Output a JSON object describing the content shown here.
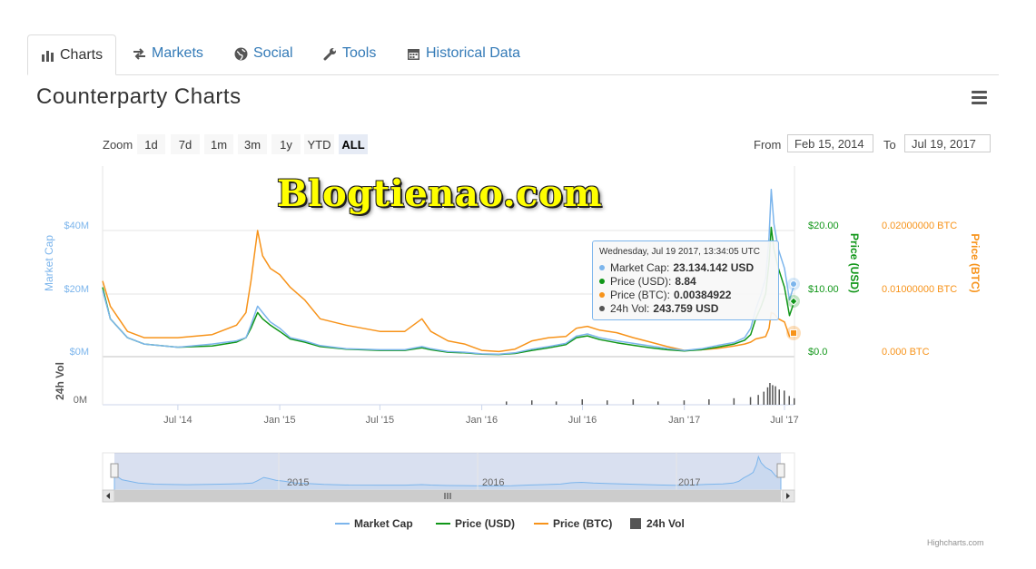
{
  "tabs": [
    {
      "label": "Charts",
      "icon": "bar-chart-icon"
    },
    {
      "label": "Markets",
      "icon": "exchange-icon"
    },
    {
      "label": "Social",
      "icon": "globe-icon"
    },
    {
      "label": "Tools",
      "icon": "wrench-icon"
    },
    {
      "label": "Historical Data",
      "icon": "calendar-icon"
    }
  ],
  "page_title": "Counterparty Charts",
  "zoom": {
    "label": "Zoom",
    "buttons": [
      "1d",
      "7d",
      "1m",
      "3m",
      "1y",
      "YTD",
      "ALL"
    ],
    "selected": "ALL"
  },
  "range": {
    "from_label": "From",
    "from_value": "Feb 15, 2014",
    "to_label": "To",
    "to_value": "Jul 19, 2017"
  },
  "watermark": "Blogtienao.com",
  "tooltip": {
    "header": "Wednesday, Jul 19 2017, 13:34:05 UTC",
    "rows": [
      {
        "name": "Market Cap",
        "value": "23.134.142 USD"
      },
      {
        "name": "Price (USD)",
        "value": "8.84"
      },
      {
        "name": "Price (BTC)",
        "value": "0.00384922"
      },
      {
        "name": "24h Vol",
        "value": "243.759 USD"
      }
    ]
  },
  "legend": [
    "Market Cap",
    "Price (USD)",
    "Price (BTC)",
    "24h Vol"
  ],
  "credits": "Highcharts.com",
  "colors": {
    "market_cap": "#7cb5ec",
    "price_usd": "#109618",
    "price_btc": "#f7931a",
    "volume": "#555555",
    "link": "#337ab7"
  },
  "chart_data": {
    "type": "line",
    "x_ticks": [
      "Jul '14",
      "Jan '15",
      "Jul '15",
      "Jan '16",
      "Jul '16",
      "Jan '17",
      "Jul '17"
    ],
    "axes": {
      "market_cap": {
        "label": "Market Cap",
        "ticks": [
          "$0M",
          "$20M",
          "$40M"
        ],
        "range": [
          0,
          40
        ]
      },
      "price_usd": {
        "label": "Price (USD)",
        "ticks": [
          "$0.0",
          "$10.00",
          "$20.00"
        ],
        "range": [
          0,
          20
        ]
      },
      "price_btc": {
        "label": "Price (BTC)",
        "ticks": [
          "0.000 BTC",
          "0.01000000 BTC",
          "0.02000000 BTC"
        ],
        "range": [
          0,
          0.02
        ]
      },
      "volume": {
        "label": "24h Vol",
        "ticks": [
          "0M"
        ]
      }
    },
    "x_range": [
      "2014-02-15",
      "2017-07-19"
    ],
    "navigator_ticks": [
      "2015",
      "2016",
      "2017"
    ],
    "series": [
      {
        "name": "Market Cap",
        "unit": "$M",
        "points": [
          [
            "2014-02-15",
            21
          ],
          [
            "2014-03-01",
            12
          ],
          [
            "2014-04-01",
            6
          ],
          [
            "2014-05-01",
            4
          ],
          [
            "2014-07-01",
            3
          ],
          [
            "2014-09-01",
            4
          ],
          [
            "2014-10-15",
            5
          ],
          [
            "2014-11-01",
            6
          ],
          [
            "2014-11-10",
            10
          ],
          [
            "2014-11-22",
            16
          ],
          [
            "2014-12-01",
            14
          ],
          [
            "2014-12-15",
            11
          ],
          [
            "2015-01-01",
            9
          ],
          [
            "2015-01-20",
            6
          ],
          [
            "2015-02-15",
            5
          ],
          [
            "2015-03-15",
            3.5
          ],
          [
            "2015-05-01",
            2.5
          ],
          [
            "2015-07-01",
            2.2
          ],
          [
            "2015-08-15",
            2.2
          ],
          [
            "2015-09-15",
            3.2
          ],
          [
            "2015-10-01",
            2.5
          ],
          [
            "2015-11-01",
            1.6
          ],
          [
            "2015-12-01",
            1.4
          ],
          [
            "2016-01-01",
            0.9
          ],
          [
            "2016-02-01",
            0.8
          ],
          [
            "2016-03-01",
            1.2
          ],
          [
            "2016-04-01",
            2.4
          ],
          [
            "2016-05-01",
            3.2
          ],
          [
            "2016-06-01",
            4.2
          ],
          [
            "2016-06-20",
            6.5
          ],
          [
            "2016-07-10",
            7.2
          ],
          [
            "2016-08-01",
            6
          ],
          [
            "2016-09-01",
            5
          ],
          [
            "2016-10-01",
            4.2
          ],
          [
            "2016-11-01",
            3.4
          ],
          [
            "2016-12-01",
            2.6
          ],
          [
            "2017-01-01",
            2
          ],
          [
            "2017-02-01",
            2.5
          ],
          [
            "2017-03-01",
            3.5
          ],
          [
            "2017-04-01",
            4.5
          ],
          [
            "2017-04-20",
            6
          ],
          [
            "2017-05-01",
            9
          ],
          [
            "2017-05-10",
            15
          ],
          [
            "2017-05-20",
            20
          ],
          [
            "2017-05-28",
            25
          ],
          [
            "2017-06-03",
            38
          ],
          [
            "2017-06-07",
            53
          ],
          [
            "2017-06-12",
            42
          ],
          [
            "2017-06-20",
            34
          ],
          [
            "2017-07-01",
            28
          ],
          [
            "2017-07-10",
            18
          ],
          [
            "2017-07-19",
            23.1
          ]
        ]
      },
      {
        "name": "Price (USD)",
        "unit": "USD",
        "points": [
          [
            "2014-02-15",
            11
          ],
          [
            "2014-03-01",
            6
          ],
          [
            "2014-04-01",
            3
          ],
          [
            "2014-05-01",
            2
          ],
          [
            "2014-07-01",
            1.5
          ],
          [
            "2014-09-01",
            1.7
          ],
          [
            "2014-10-15",
            2.3
          ],
          [
            "2014-11-01",
            3
          ],
          [
            "2014-11-10",
            4.5
          ],
          [
            "2014-11-22",
            7
          ],
          [
            "2014-12-01",
            6
          ],
          [
            "2014-12-15",
            5
          ],
          [
            "2015-01-01",
            4
          ],
          [
            "2015-01-20",
            2.8
          ],
          [
            "2015-02-15",
            2.3
          ],
          [
            "2015-03-15",
            1.6
          ],
          [
            "2015-05-01",
            1.2
          ],
          [
            "2015-07-01",
            1
          ],
          [
            "2015-08-15",
            1
          ],
          [
            "2015-09-15",
            1.4
          ],
          [
            "2015-10-01",
            1.1
          ],
          [
            "2015-11-01",
            0.7
          ],
          [
            "2015-12-01",
            0.6
          ],
          [
            "2016-01-01",
            0.4
          ],
          [
            "2016-02-01",
            0.35
          ],
          [
            "2016-03-01",
            0.5
          ],
          [
            "2016-04-01",
            1
          ],
          [
            "2016-05-01",
            1.4
          ],
          [
            "2016-06-01",
            1.9
          ],
          [
            "2016-06-20",
            3
          ],
          [
            "2016-07-10",
            3.3
          ],
          [
            "2016-08-01",
            2.7
          ],
          [
            "2016-09-01",
            2.2
          ],
          [
            "2016-10-01",
            1.8
          ],
          [
            "2016-11-01",
            1.4
          ],
          [
            "2016-12-01",
            1.1
          ],
          [
            "2017-01-01",
            0.9
          ],
          [
            "2017-02-01",
            1.1
          ],
          [
            "2017-03-01",
            1.5
          ],
          [
            "2017-04-01",
            2
          ],
          [
            "2017-04-20",
            2.6
          ],
          [
            "2017-05-01",
            3.5
          ],
          [
            "2017-05-10",
            6
          ],
          [
            "2017-05-20",
            8
          ],
          [
            "2017-05-28",
            10
          ],
          [
            "2017-06-03",
            15
          ],
          [
            "2017-06-07",
            20.5
          ],
          [
            "2017-06-12",
            17
          ],
          [
            "2017-06-20",
            14
          ],
          [
            "2017-07-01",
            11
          ],
          [
            "2017-07-10",
            6.5
          ],
          [
            "2017-07-19",
            8.84
          ]
        ]
      },
      {
        "name": "Price (BTC)",
        "unit": "BTC",
        "points": [
          [
            "2014-02-15",
            0.012
          ],
          [
            "2014-03-01",
            0.008
          ],
          [
            "2014-04-01",
            0.004
          ],
          [
            "2014-05-01",
            0.003
          ],
          [
            "2014-07-01",
            0.003
          ],
          [
            "2014-09-01",
            0.0035
          ],
          [
            "2014-10-15",
            0.005
          ],
          [
            "2014-11-01",
            0.007
          ],
          [
            "2014-11-10",
            0.012
          ],
          [
            "2014-11-22",
            0.02
          ],
          [
            "2014-12-01",
            0.016
          ],
          [
            "2014-12-15",
            0.014
          ],
          [
            "2015-01-01",
            0.013
          ],
          [
            "2015-01-20",
            0.011
          ],
          [
            "2015-02-15",
            0.009
          ],
          [
            "2015-03-15",
            0.006
          ],
          [
            "2015-05-01",
            0.005
          ],
          [
            "2015-07-01",
            0.004
          ],
          [
            "2015-08-15",
            0.004
          ],
          [
            "2015-09-15",
            0.006
          ],
          [
            "2015-10-01",
            0.004
          ],
          [
            "2015-11-01",
            0.0025
          ],
          [
            "2015-12-01",
            0.002
          ],
          [
            "2016-01-01",
            0.001
          ],
          [
            "2016-02-01",
            0.0008
          ],
          [
            "2016-03-01",
            0.0012
          ],
          [
            "2016-04-01",
            0.0025
          ],
          [
            "2016-05-01",
            0.003
          ],
          [
            "2016-06-01",
            0.0032
          ],
          [
            "2016-06-20",
            0.0045
          ],
          [
            "2016-07-10",
            0.0048
          ],
          [
            "2016-08-01",
            0.0042
          ],
          [
            "2016-09-01",
            0.0038
          ],
          [
            "2016-10-01",
            0.003
          ],
          [
            "2016-11-01",
            0.0023
          ],
          [
            "2016-12-01",
            0.0016
          ],
          [
            "2017-01-01",
            0.001
          ],
          [
            "2017-02-01",
            0.0011
          ],
          [
            "2017-03-01",
            0.0013
          ],
          [
            "2017-04-01",
            0.0017
          ],
          [
            "2017-04-20",
            0.002
          ],
          [
            "2017-05-01",
            0.0023
          ],
          [
            "2017-05-10",
            0.0028
          ],
          [
            "2017-05-20",
            0.003
          ],
          [
            "2017-05-28",
            0.0032
          ],
          [
            "2017-06-03",
            0.0045
          ],
          [
            "2017-06-07",
            0.007
          ],
          [
            "2017-06-12",
            0.0068
          ],
          [
            "2017-06-20",
            0.006
          ],
          [
            "2017-07-01",
            0.0055
          ],
          [
            "2017-07-10",
            0.0032
          ],
          [
            "2017-07-19",
            0.00384922
          ]
        ]
      }
    ],
    "volume_series": {
      "name": "24h Vol",
      "unit": "USD (relative)",
      "points": [
        [
          "2016-02-15",
          0.15
        ],
        [
          "2016-04-01",
          0.2
        ],
        [
          "2016-05-15",
          0.15
        ],
        [
          "2016-07-01",
          0.25
        ],
        [
          "2016-08-15",
          0.2
        ],
        [
          "2016-10-01",
          0.25
        ],
        [
          "2016-11-15",
          0.15
        ],
        [
          "2017-01-01",
          0.2
        ],
        [
          "2017-02-15",
          0.25
        ],
        [
          "2017-04-01",
          0.3
        ],
        [
          "2017-05-01",
          0.35
        ],
        [
          "2017-05-15",
          0.45
        ],
        [
          "2017-05-25",
          0.6
        ],
        [
          "2017-06-01",
          0.8
        ],
        [
          "2017-06-05",
          1.0
        ],
        [
          "2017-06-10",
          0.9
        ],
        [
          "2017-06-15",
          0.85
        ],
        [
          "2017-06-22",
          0.7
        ],
        [
          "2017-07-01",
          0.65
        ],
        [
          "2017-07-10",
          0.4
        ],
        [
          "2017-07-19",
          0.3
        ]
      ]
    },
    "legend_position": "bottom"
  }
}
